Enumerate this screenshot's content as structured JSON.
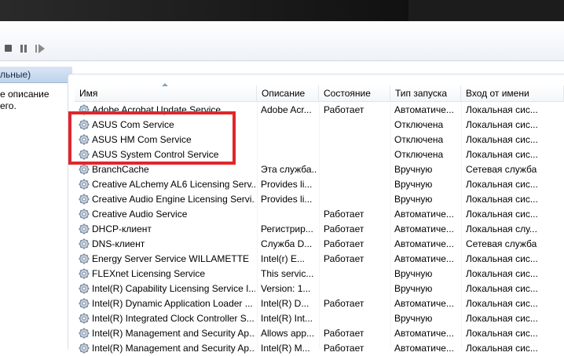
{
  "colors": {
    "highlight_box": "#e0262b",
    "header_band": "#c7d8ec"
  },
  "toolbar": {
    "buttons": [
      {
        "name": "stop-service-button",
        "icon": "stop-icon"
      },
      {
        "name": "pause-service-button",
        "icon": "pause-icon"
      },
      {
        "name": "restart-service-button",
        "icon": "restart-icon"
      }
    ]
  },
  "left_panel": {
    "header_fragment": "льные)",
    "description_lines": [
      "е описание",
      "его."
    ]
  },
  "table": {
    "columns": [
      "Имя",
      "Описание",
      "Состояние",
      "Тип запуска",
      "Вход от имени"
    ],
    "rows": [
      {
        "name": "Adobe Acrobat Update Service",
        "description": "Adobe Acr...",
        "status": "Работает",
        "startup": "Автоматиче...",
        "logon": "Локальная сис..."
      },
      {
        "name": "ASUS Com Service",
        "description": "",
        "status": "",
        "startup": "Отключена",
        "logon": "Локальная сис..."
      },
      {
        "name": "ASUS HM Com Service",
        "description": "",
        "status": "",
        "startup": "Отключена",
        "logon": "Локальная сис..."
      },
      {
        "name": "ASUS System Control Service",
        "description": "",
        "status": "",
        "startup": "Отключена",
        "logon": "Локальная сис..."
      },
      {
        "name": "BranchCache",
        "description": "Эта служба...",
        "status": "",
        "startup": "Вручную",
        "logon": "Сетевая служба"
      },
      {
        "name": "Creative ALchemy AL6 Licensing Serv...",
        "description": "Provides li...",
        "status": "",
        "startup": "Вручную",
        "logon": "Локальная сис..."
      },
      {
        "name": "Creative Audio Engine Licensing Servi...",
        "description": "Provides li...",
        "status": "",
        "startup": "Вручную",
        "logon": "Локальная сис..."
      },
      {
        "name": "Creative Audio Service",
        "description": "",
        "status": "Работает",
        "startup": "Автоматиче...",
        "logon": "Локальная сис..."
      },
      {
        "name": "DHCP-клиент",
        "description": "Регистрир...",
        "status": "Работает",
        "startup": "Автоматиче...",
        "logon": "Локальная слу..."
      },
      {
        "name": "DNS-клиент",
        "description": "Служба D...",
        "status": "Работает",
        "startup": "Автоматиче...",
        "logon": "Сетевая служба"
      },
      {
        "name": "Energy Server Service WILLAMETTE",
        "description": "Intel(r) E...",
        "status": "Работает",
        "startup": "Автоматиче...",
        "logon": "Локальная сис..."
      },
      {
        "name": "FLEXnet Licensing Service",
        "description": "This servic...",
        "status": "",
        "startup": "Вручную",
        "logon": "Локальная сис..."
      },
      {
        "name": "Intel(R) Capability Licensing Service I...",
        "description": "Version: 1...",
        "status": "",
        "startup": "Вручную",
        "logon": "Локальная сис..."
      },
      {
        "name": "Intel(R) Dynamic Application Loader ...",
        "description": "Intel(R) D...",
        "status": "Работает",
        "startup": "Автоматиче...",
        "logon": "Локальная сис..."
      },
      {
        "name": "Intel(R) Integrated Clock Controller S...",
        "description": "Intel(R) Int...",
        "status": "",
        "startup": "Вручную",
        "logon": "Локальная сис..."
      },
      {
        "name": "Intel(R) Management and Security Ap...",
        "description": "Allows app...",
        "status": "Работает",
        "startup": "Автоматиче...",
        "logon": "Локальная сис..."
      },
      {
        "name": "Intel(R) Management and Security Ap...",
        "description": "Intel(R) M...",
        "status": "Работает",
        "startup": "Автоматиче...",
        "logon": "Локальная сис..."
      }
    ]
  }
}
